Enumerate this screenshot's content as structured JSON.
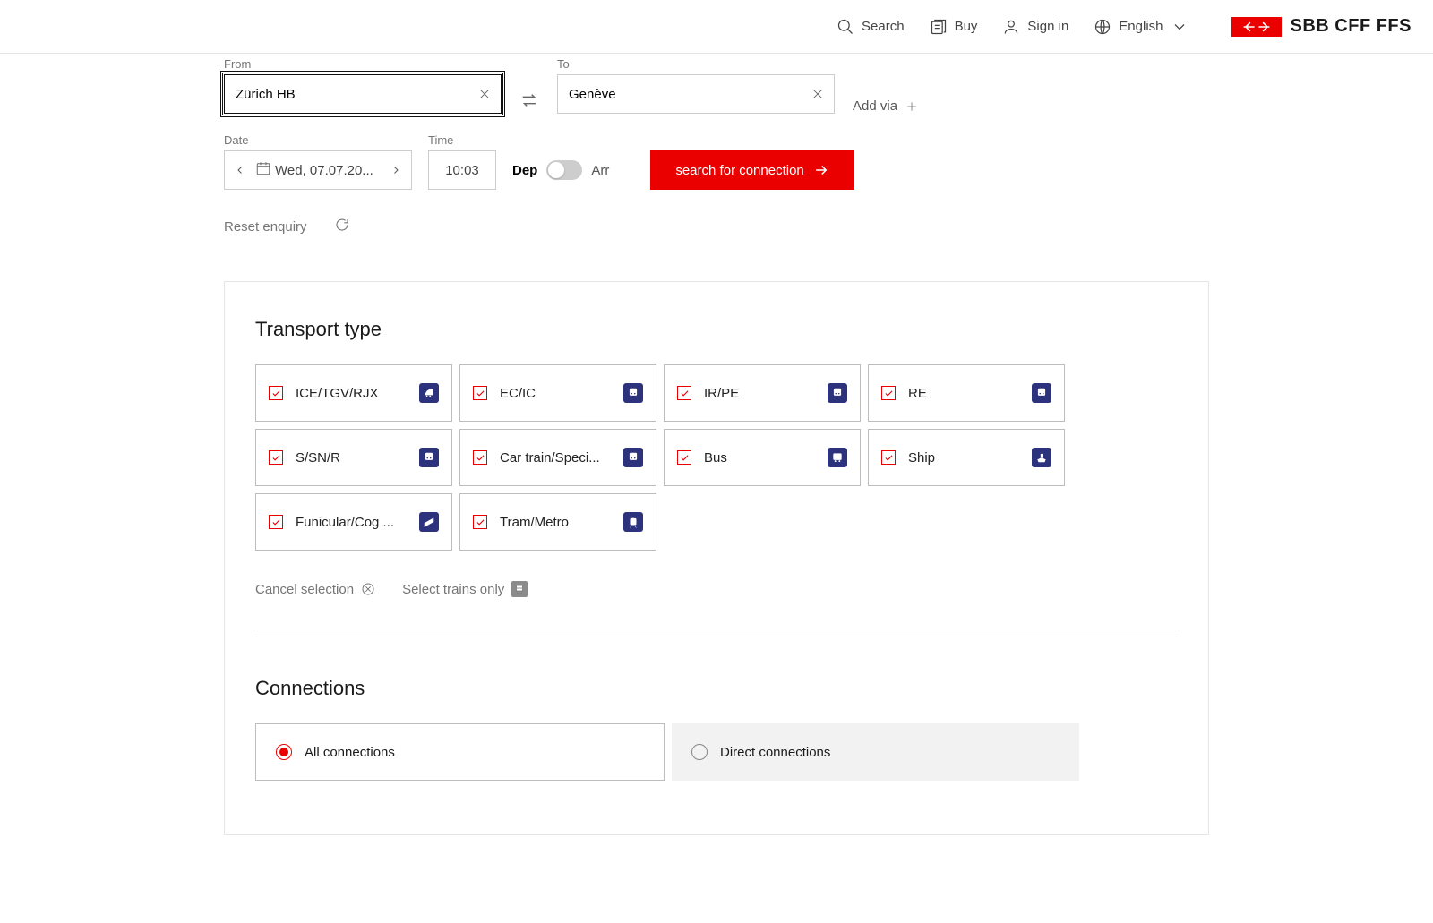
{
  "header": {
    "search": "Search",
    "buy": "Buy",
    "signin": "Sign in",
    "language": "English",
    "brand": "SBB CFF FFS"
  },
  "journey": {
    "from_label": "From",
    "from_value": "Zürich HB",
    "to_label": "To",
    "to_value": "Genève",
    "add_via": "Add via",
    "date_label": "Date",
    "date_value": "Wed, 07.07.20...",
    "time_label": "Time",
    "time_value": "10:03",
    "dep": "Dep",
    "arr": "Arr",
    "search_btn": "search for connection",
    "reset": "Reset enquiry"
  },
  "transport": {
    "title": "Transport type",
    "items": [
      {
        "label": "ICE/TGV/RJX",
        "icon": "hst"
      },
      {
        "label": "EC/IC",
        "icon": "train"
      },
      {
        "label": "IR/PE",
        "icon": "train"
      },
      {
        "label": "RE",
        "icon": "train"
      },
      {
        "label": "S/SN/R",
        "icon": "train"
      },
      {
        "label": "Car train/Speci...",
        "icon": "train"
      },
      {
        "label": "Bus",
        "icon": "bus"
      },
      {
        "label": "Ship",
        "icon": "ship"
      },
      {
        "label": "Funicular/Cog ...",
        "icon": "funicular"
      },
      {
        "label": "Tram/Metro",
        "icon": "tram"
      }
    ],
    "cancel": "Cancel selection",
    "trains_only": "Select trains only"
  },
  "connections": {
    "title": "Connections",
    "all": "All connections",
    "direct": "Direct connections",
    "selected": "all"
  }
}
